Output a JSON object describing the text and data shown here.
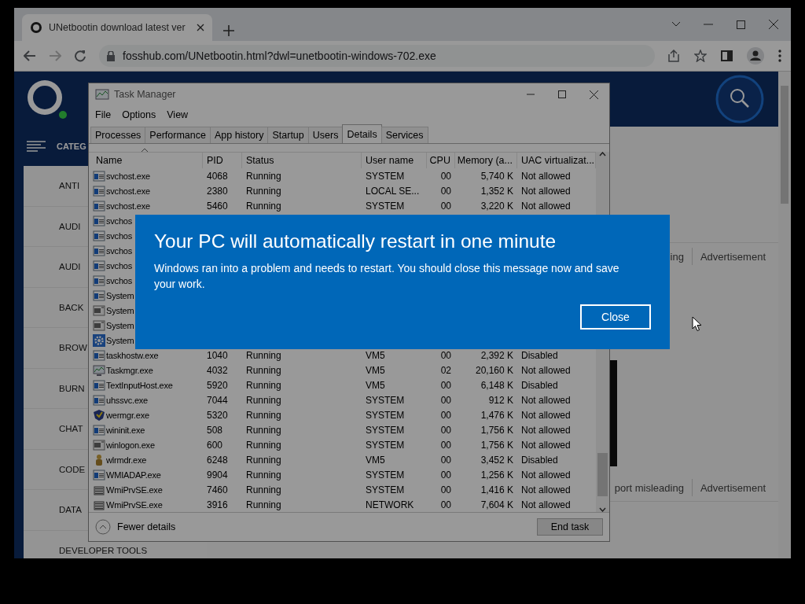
{
  "browser": {
    "tab": {
      "title": "UNetbootin download latest ver"
    },
    "url": "fosshub.com/UNetbootin.html?dwl=unetbootin-windows-702.exe"
  },
  "site": {
    "categories_label": "CATEG",
    "categories": [
      {
        "label": "ANTI"
      },
      {
        "label": "AUDI"
      },
      {
        "label": "AUDI"
      },
      {
        "label": "BACK"
      },
      {
        "label": "BROW"
      },
      {
        "label": "BURN"
      },
      {
        "label": "CHAT"
      },
      {
        "label": "CODE"
      },
      {
        "label": "DATA"
      },
      {
        "label": "DEVELOPER TOOLS"
      }
    ],
    "ads": [
      {
        "report": "ing",
        "label": "Advertisement"
      },
      {
        "report": "port misleading",
        "label": "Advertisement"
      }
    ]
  },
  "task_manager": {
    "title": "Task Manager",
    "menu": [
      "File",
      "Options",
      "View"
    ],
    "tabs": [
      {
        "label": "Processes",
        "selected": false
      },
      {
        "label": "Performance",
        "selected": false
      },
      {
        "label": "App history",
        "selected": false
      },
      {
        "label": "Startup",
        "selected": false
      },
      {
        "label": "Users",
        "selected": false
      },
      {
        "label": "Details",
        "selected": true
      },
      {
        "label": "Services",
        "selected": false
      }
    ],
    "columns": [
      "Name",
      "PID",
      "Status",
      "User name",
      "CPU",
      "Memory (a...",
      "UAC virtualizat..."
    ],
    "rows": [
      {
        "kind": "service",
        "cells": [
          "svchost.exe",
          "4068",
          "Running",
          "SYSTEM",
          "00",
          "5,740 K",
          "Not allowed"
        ]
      },
      {
        "kind": "service",
        "cells": [
          "svchost.exe",
          "2380",
          "Running",
          "LOCAL SE...",
          "00",
          "1,352 K",
          "Not allowed"
        ]
      },
      {
        "kind": "service",
        "cells": [
          "svchost.exe",
          "5460",
          "Running",
          "SYSTEM",
          "00",
          "3,220 K",
          "Not allowed"
        ]
      },
      {
        "kind": "service",
        "cells": [
          "svchos"
        ]
      },
      {
        "kind": "service",
        "cells": [
          "svchos"
        ]
      },
      {
        "kind": "service",
        "cells": [
          "svchos"
        ]
      },
      {
        "kind": "service",
        "cells": [
          "svchos"
        ]
      },
      {
        "kind": "service",
        "cells": [
          "svchos"
        ]
      },
      {
        "kind": "service",
        "cells": [
          "System"
        ]
      },
      {
        "kind": "app",
        "cells": [
          "System"
        ]
      },
      {
        "kind": "app",
        "cells": [
          "System"
        ]
      },
      {
        "kind": "gear",
        "cells": [
          "System"
        ]
      },
      {
        "kind": "service",
        "cells": [
          "taskhostw.exe",
          "1040",
          "Running",
          "VM5",
          "00",
          "2,392 K",
          "Disabled"
        ]
      },
      {
        "kind": "monitor",
        "cells": [
          "Taskmgr.exe",
          "4032",
          "Running",
          "VM5",
          "02",
          "20,160 K",
          "Not allowed"
        ]
      },
      {
        "kind": "service",
        "cells": [
          "TextInputHost.exe",
          "5920",
          "Running",
          "VM5",
          "00",
          "6,148 K",
          "Disabled"
        ]
      },
      {
        "kind": "service",
        "cells": [
          "uhssvc.exe",
          "7044",
          "Running",
          "SYSTEM",
          "00",
          "912 K",
          "Not allowed"
        ]
      },
      {
        "kind": "shield",
        "cells": [
          "wermgr.exe",
          "5320",
          "Running",
          "SYSTEM",
          "00",
          "1,476 K",
          "Not allowed"
        ]
      },
      {
        "kind": "service",
        "cells": [
          "wininit.exe",
          "508",
          "Running",
          "SYSTEM",
          "00",
          "1,756 K",
          "Not allowed"
        ]
      },
      {
        "kind": "app",
        "cells": [
          "winlogon.exe",
          "600",
          "Running",
          "SYSTEM",
          "00",
          "1,756 K",
          "Not allowed"
        ]
      },
      {
        "kind": "figure",
        "cells": [
          "wlrmdr.exe",
          "6248",
          "Running",
          "VM5",
          "00",
          "3,452 K",
          "Disabled"
        ]
      },
      {
        "kind": "service",
        "cells": [
          "WMIADAP.exe",
          "9904",
          "Running",
          "SYSTEM",
          "00",
          "1,256 K",
          "Not allowed"
        ]
      },
      {
        "kind": "server",
        "cells": [
          "WmiPrvSE.exe",
          "7460",
          "Running",
          "SYSTEM",
          "00",
          "1,416 K",
          "Not allowed"
        ]
      },
      {
        "kind": "server",
        "cells": [
          "WmiPrvSE.exe",
          "3916",
          "Running",
          "NETWORK",
          "00",
          "7,604 K",
          "Not allowed"
        ]
      }
    ],
    "footer": {
      "toggle": "Fewer details",
      "button": "End task"
    }
  },
  "dialog": {
    "title": "Your PC will automatically restart in one minute",
    "message": "Windows ran into a problem and needs to restart. You should close this message now and save your work.",
    "button": "Close"
  }
}
